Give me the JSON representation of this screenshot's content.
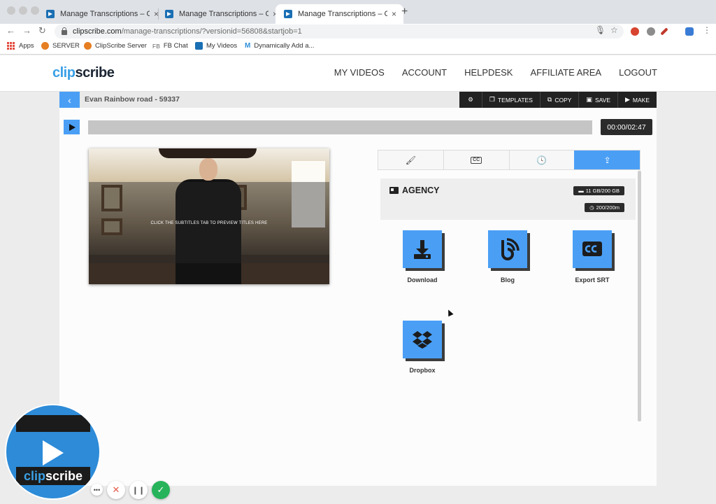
{
  "browser": {
    "tabs": [
      {
        "title": "Manage Transcriptions – ClipScribe",
        "close": "×"
      },
      {
        "title": "Manage Transcriptions – ClipScribe",
        "close": "×"
      },
      {
        "title": "Manage Transcriptions – ClipScribe",
        "close": "×"
      }
    ],
    "new_tab": "+",
    "url_host": "clipscribe.com",
    "url_path": "/manage-transcriptions/?versionid=56808&startjob=1",
    "bookmarks": [
      "Apps",
      "SERVER",
      "ClipScribe Server",
      "FB Chat",
      "My Videos",
      "Dynamically Add a..."
    ],
    "bookmark_icon_text": {
      "fb": "FB",
      "m": "M"
    }
  },
  "site": {
    "logo_clip": "clip",
    "logo_scribe": "scribe",
    "nav": [
      "MY VIDEOS",
      "ACCOUNT",
      "HELPDESK",
      "AFFILIATE AREA",
      "LOGOUT"
    ]
  },
  "editor": {
    "project_title": "Evan Rainbow road - 59337",
    "tools": {
      "templates": "TEMPLATES",
      "copy": "COPY",
      "save": "SAVE",
      "make": "MAKE"
    },
    "timecode": "00:00/02:47",
    "video_hint": "CLICK THE SUBTITLES TAB TO PREVIEW TITLES HERE"
  },
  "panel": {
    "cc_label": "CC",
    "account_name": "AGENCY",
    "storage": "11 GB/200 GB",
    "minutes": "200/200m",
    "exports": [
      {
        "label": "Download",
        "icon": "download-icon"
      },
      {
        "label": "Blog",
        "icon": "blog-icon"
      },
      {
        "label": "Export SRT",
        "icon": "cc-icon"
      },
      {
        "label": "Dropbox",
        "icon": "dropbox-icon"
      }
    ]
  },
  "badge": {
    "clip": "clip",
    "scribe": "scribe"
  },
  "colors": {
    "accent": "#4a9ff5",
    "dark": "#2b2b2b",
    "confirm": "#27b35a"
  }
}
